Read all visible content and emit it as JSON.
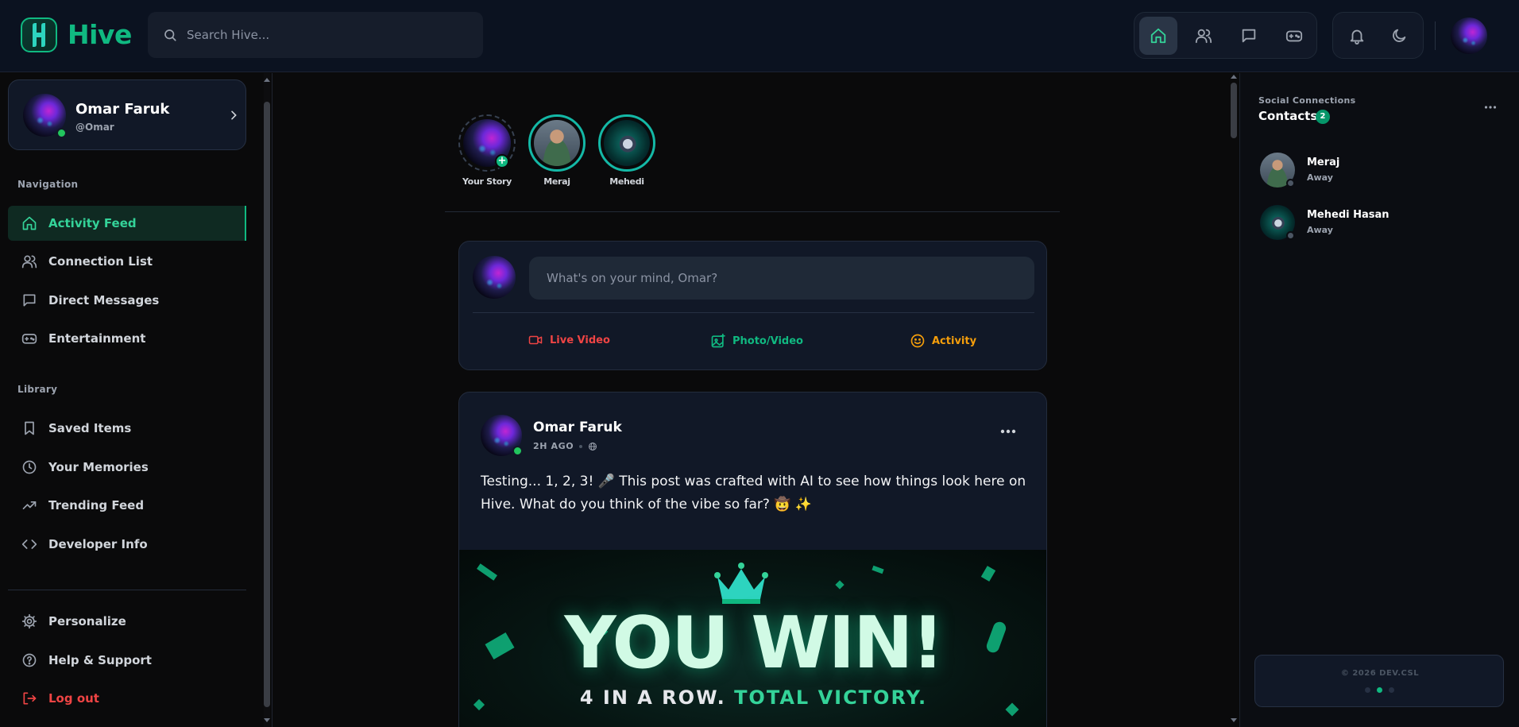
{
  "app": {
    "name": "Hive",
    "brand_color": "#10b981"
  },
  "search": {
    "placeholder": "Search Hive..."
  },
  "topnav": {
    "items": [
      {
        "icon": "home-icon",
        "active": true
      },
      {
        "icon": "users-icon",
        "active": false
      },
      {
        "icon": "message-icon",
        "active": false
      },
      {
        "icon": "gamepad-icon",
        "active": false
      }
    ],
    "utilities": [
      "bell-icon",
      "moon-icon"
    ]
  },
  "profile": {
    "name": "Omar Faruk",
    "handle": "@Omar",
    "status": "online"
  },
  "sidebar": {
    "navigation_title": "Navigation",
    "navigation": [
      {
        "label": "Activity Feed",
        "icon": "home-icon",
        "active": true
      },
      {
        "label": "Connection List",
        "icon": "users-icon"
      },
      {
        "label": "Direct Messages",
        "icon": "message-icon"
      },
      {
        "label": "Entertainment",
        "icon": "gamepad-icon"
      }
    ],
    "library_title": "Library",
    "library": [
      {
        "label": "Saved Items",
        "icon": "bookmark-icon"
      },
      {
        "label": "Your Memories",
        "icon": "clock-icon"
      },
      {
        "label": "Trending Feed",
        "icon": "trending-icon"
      },
      {
        "label": "Developer Info",
        "icon": "code-icon"
      }
    ],
    "bottom": [
      {
        "label": "Personalize",
        "icon": "gear-icon"
      },
      {
        "label": "Help & Support",
        "icon": "help-icon"
      },
      {
        "label": "Log out",
        "icon": "logout-icon"
      }
    ]
  },
  "stories": [
    {
      "label": "Your Story",
      "own": true
    },
    {
      "label": "Meraj"
    },
    {
      "label": "Mehedi"
    }
  ],
  "composer": {
    "placeholder": "What's on your mind, Omar?",
    "actions": [
      {
        "label": "Live Video",
        "color": "#ef4444",
        "icon": "video-icon"
      },
      {
        "label": "Photo/Video",
        "color": "#10b981",
        "icon": "image-icon"
      },
      {
        "label": "Activity",
        "color": "#f59e0b",
        "icon": "smile-icon"
      }
    ]
  },
  "post": {
    "author": "Omar Faruk",
    "time": "2H AGO",
    "visibility": "globe-icon",
    "text": "Testing... 1, 2, 3! 🎤 This post was crafted with AI to see how things look here on Hive. What do you think of the vibe so far? 🤠 ✨",
    "banner": {
      "headline": "YOU WIN!",
      "sub_a": "4 IN A ROW.",
      "sub_b": "TOTAL VICTORY."
    }
  },
  "contacts": {
    "kicker": "Social Connections",
    "title": "Contacts",
    "count": "2",
    "items": [
      {
        "name": "Meraj",
        "status": "Away"
      },
      {
        "name": "Mehedi Hasan",
        "status": "Away"
      }
    ]
  },
  "footer": {
    "copyright": "© 2026 DEV.CSL"
  }
}
